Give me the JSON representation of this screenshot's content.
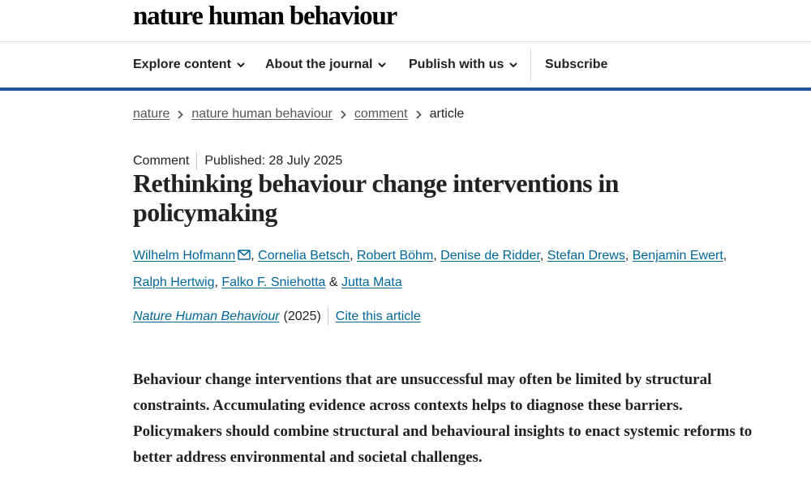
{
  "site": {
    "brand": "nature human behaviour"
  },
  "nav": {
    "items": [
      {
        "label": "Explore content"
      },
      {
        "label": "About the journal"
      },
      {
        "label": "Publish with us"
      }
    ],
    "subscribe": "Subscribe"
  },
  "breadcrumb": {
    "links": [
      "nature",
      "nature human behaviour",
      "comment"
    ],
    "current": "article"
  },
  "article": {
    "type": "Comment",
    "published": "Published: 28 July 2025",
    "title": "Rethinking behaviour change interventions in policymaking",
    "authors": [
      "Wilhelm Hofmann",
      "Cornelia Betsch",
      "Robert Böhm",
      "Denise de Ridder",
      "Stefan Drews",
      "Benjamin Ewert",
      "Ralph Hertwig",
      "Falko F. Sniehotta",
      "Jutta Mata"
    ],
    "journal": "Nature Human Behaviour",
    "year": "(2025)",
    "cite": "Cite this article",
    "standfirst": "Behaviour change interventions that are unsuccessful may often be limited by structural constraints. Accumulating evidence across contexts helps to diagnose these barriers. Policymakers should combine structural and behavioural insights to enact systemic reforms to better address environmental and societal challenges."
  },
  "colors": {
    "accent": "#20569e",
    "link": "#006699"
  }
}
